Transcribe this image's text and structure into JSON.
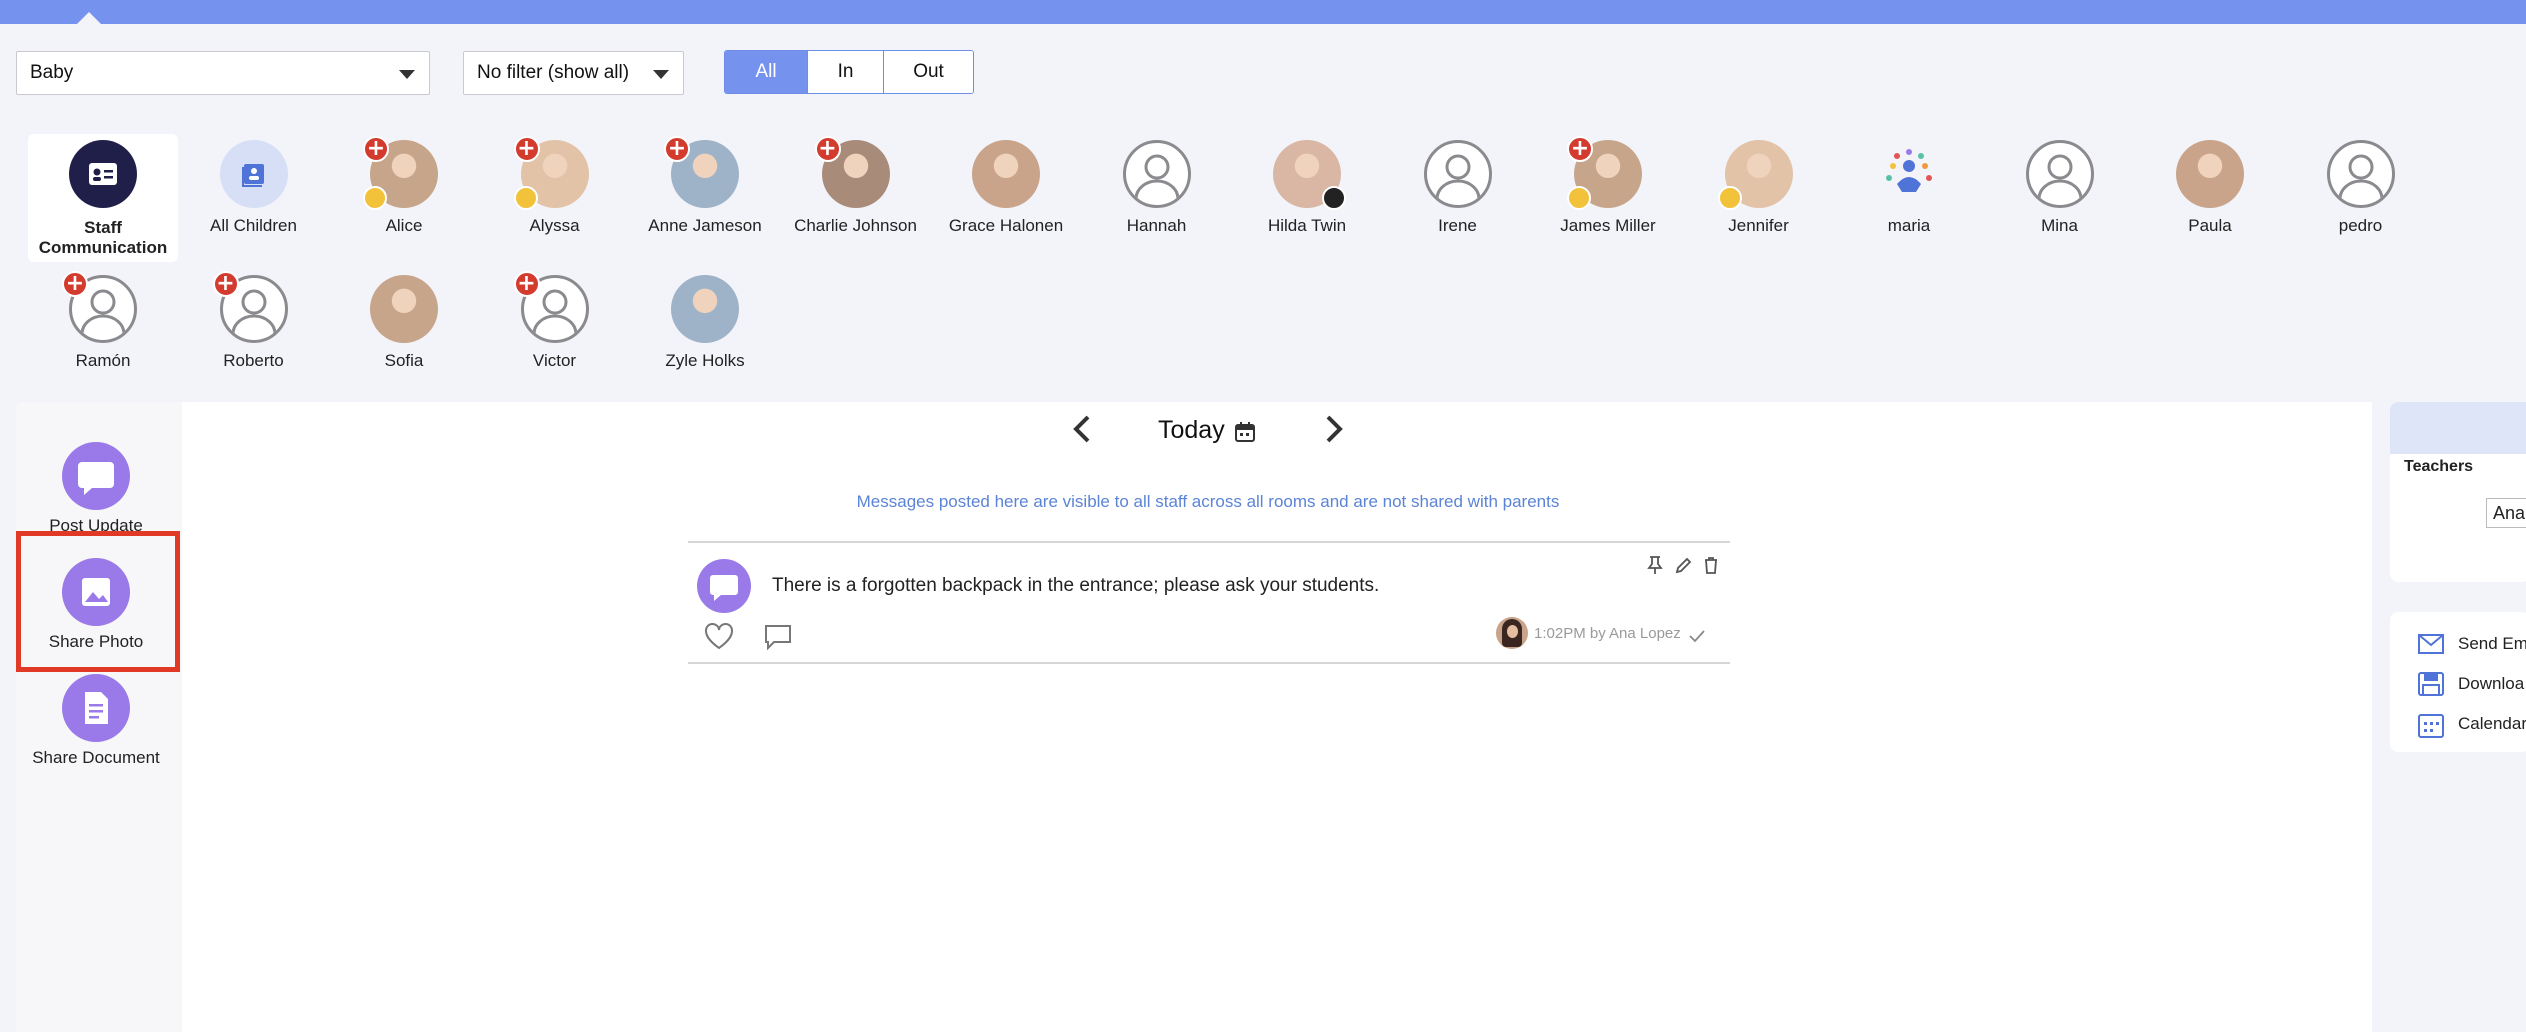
{
  "room_select": {
    "value": "Baby"
  },
  "filter_select": {
    "value": "No filter (show all)"
  },
  "status_tabs": [
    "All",
    "In",
    "Out"
  ],
  "children_row1": [
    {
      "name": "Staff Communication",
      "type": "staff"
    },
    {
      "name": "All Children",
      "type": "all"
    },
    {
      "name": "Alice",
      "plus": true,
      "star": true
    },
    {
      "name": "Alyssa",
      "plus": true,
      "star": true
    },
    {
      "name": "Anne Jameson",
      "plus": true,
      "star": false
    },
    {
      "name": "Charlie Johnson",
      "plus": true,
      "star": false
    },
    {
      "name": "Grace Halonen",
      "plus": false,
      "star": false
    },
    {
      "name": "Hannah",
      "plus": false,
      "star": false,
      "outline": true
    },
    {
      "name": "Hilda Twin",
      "plus": false,
      "star": false
    },
    {
      "name": "Irene",
      "plus": false,
      "star": false,
      "outline": true
    },
    {
      "name": "James Miller",
      "plus": true,
      "star": true
    },
    {
      "name": "Jennifer",
      "plus": false,
      "star": true
    },
    {
      "name": "maria",
      "plus": false,
      "star": false
    },
    {
      "name": "Mina",
      "plus": false,
      "star": false,
      "outline": true
    },
    {
      "name": "Paula",
      "plus": false,
      "star": false
    },
    {
      "name": "pedro",
      "plus": false,
      "star": false,
      "outline": true
    }
  ],
  "children_row2": [
    {
      "name": "Ramón",
      "plus": true,
      "outline": true
    },
    {
      "name": "Roberto",
      "plus": true,
      "outline": true
    },
    {
      "name": "Sofia",
      "plus": false
    },
    {
      "name": "Victor",
      "plus": true,
      "outline": true
    },
    {
      "name": "Zyle Holks",
      "plus": false
    }
  ],
  "actions": {
    "post_update": "Post Update",
    "share_photo": "Share Photo",
    "share_document": "Share Document"
  },
  "feed": {
    "date_label": "Today",
    "notice": "Messages posted here are visible to all staff across all rooms and are not shared with parents",
    "post_text": "There is a forgotten backpack in the entrance; please ask your students.",
    "post_meta": "1:02PM by Ana Lopez"
  },
  "right_panel": {
    "teachers_label": "Teachers",
    "teacher_value": "Ana",
    "links": [
      "Send Em",
      "Downloa",
      "Calendar"
    ]
  },
  "colors": {
    "accent": "#7592ee",
    "purple": "#9a7ae8",
    "highlight": "#e03a26",
    "notice_text": "#5b84d6"
  }
}
